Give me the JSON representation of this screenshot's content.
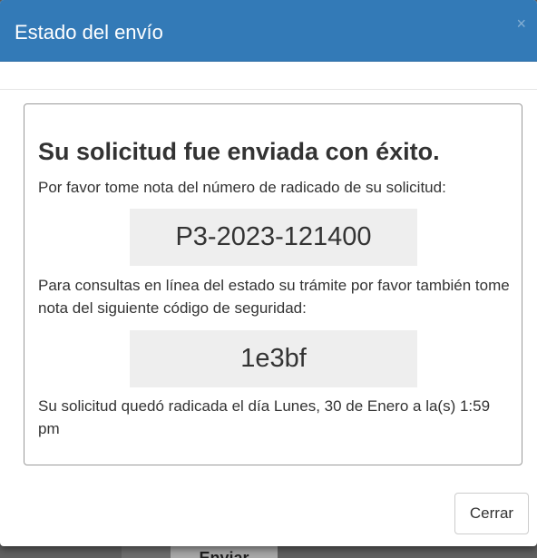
{
  "modal": {
    "title": "Estado del envío",
    "close_glyph": "×"
  },
  "panel": {
    "heading": "Su solicitud fue enviada con éxito.",
    "note_radicado": "Por favor tome nota del número de radicado de su solicitud:",
    "radicado_number": "P3-2023-121400",
    "note_security": "Para consultas en línea del estado su trámite por favor también tome nota del siguiente código de seguridad:",
    "security_code": "1e3bf",
    "filed_date": "Su solicitud quedó radicada el día Lunes, 30 de Enero a la(s) 1:59 pm"
  },
  "footer": {
    "close_label": "Cerrar"
  },
  "background": {
    "submit_label": "Enviar"
  },
  "colors": {
    "header_bg": "#337ab7",
    "code_box_bg": "#eeeeee",
    "overlay": "#5f5f5f"
  }
}
